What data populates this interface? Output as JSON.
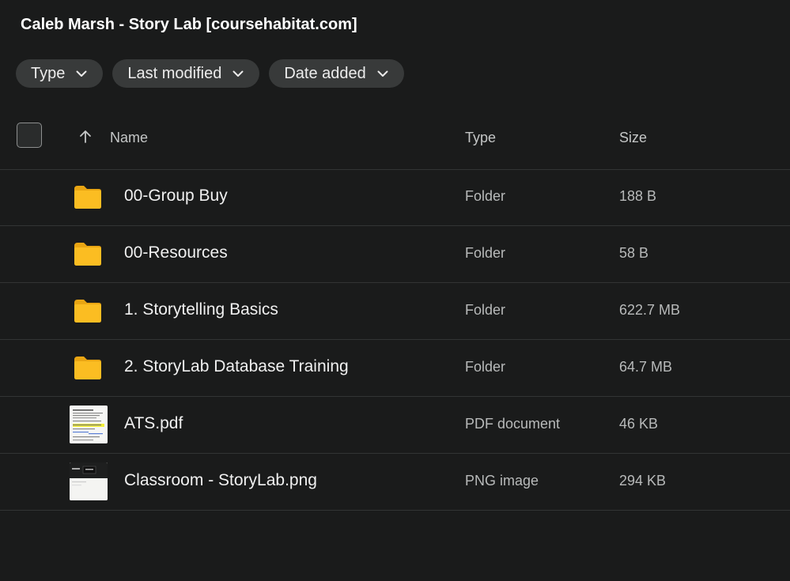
{
  "page": {
    "title": "Caleb Marsh - Story Lab [coursehabitat.com]"
  },
  "filters": [
    {
      "label": "Type",
      "icon": "chevron-down-icon"
    },
    {
      "label": "Last modified",
      "icon": "chevron-down-icon"
    },
    {
      "label": "Date added",
      "icon": "chevron-down-icon"
    }
  ],
  "table": {
    "sort_icon": "arrow-up-icon",
    "columns": {
      "name": "Name",
      "type": "Type",
      "size": "Size"
    },
    "rows": [
      {
        "name": "00-Group Buy",
        "type": "Folder",
        "size": "188 B",
        "icon": "folder-icon"
      },
      {
        "name": "00-Resources",
        "type": "Folder",
        "size": "58 B",
        "icon": "folder-icon"
      },
      {
        "name": "1. Storytelling Basics",
        "type": "Folder",
        "size": "622.7 MB",
        "icon": "folder-icon"
      },
      {
        "name": "2. StoryLab Database Training",
        "type": "Folder",
        "size": "64.7 MB",
        "icon": "folder-icon"
      },
      {
        "name": "ATS.pdf",
        "type": "PDF document",
        "size": "46 KB",
        "icon": "pdf-thumbnail"
      },
      {
        "name": "Classroom - StoryLab.png",
        "type": "PNG image",
        "size": "294 KB",
        "icon": "png-thumbnail"
      }
    ]
  },
  "colors": {
    "background": "#1a1b1b",
    "chip": "#383a3a",
    "folder": "#f7b81c",
    "divider": "#323434"
  }
}
